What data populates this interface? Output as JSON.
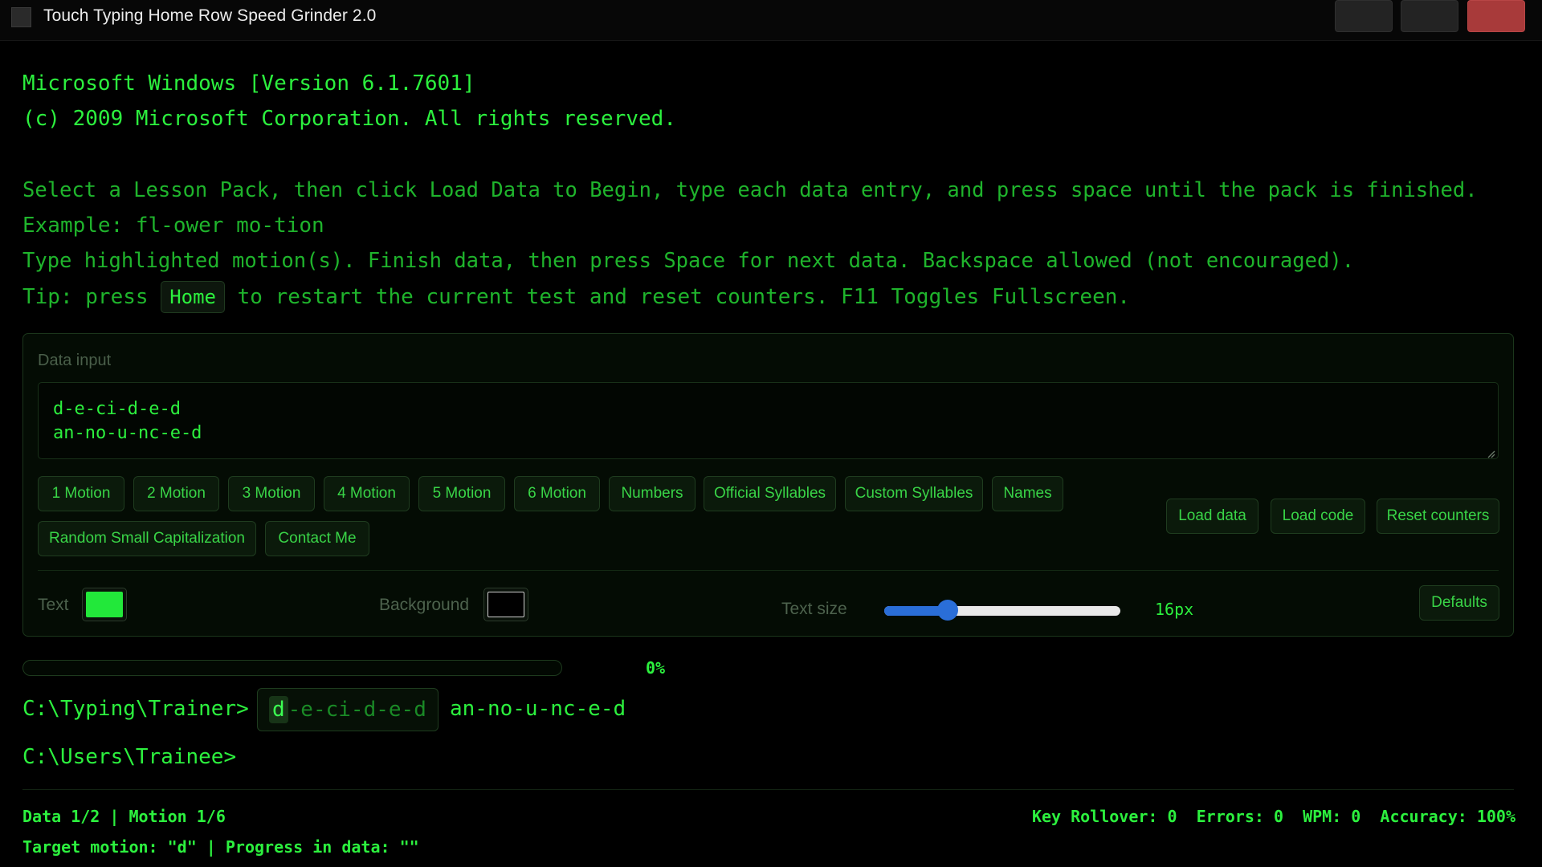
{
  "window": {
    "title": "Touch Typing Home Row Speed Grinder 2.0"
  },
  "console": {
    "version_line": "Microsoft Windows [Version 6.1.7601]",
    "copyright_line": "(c) 2009 Microsoft Corporation. All rights reserved.",
    "instruction_line": "Select a Lesson Pack, then click Load Data to Begin, type each data entry, and press space until the pack is finished.",
    "example_line": "Example: fl-ower mo-tion",
    "type_line": "Type highlighted motion(s). Finish data, then press Space for next data. Backspace allowed (not encouraged).",
    "tip_prefix": "Tip: press ",
    "tip_key": "Home",
    "tip_suffix": " to restart the current test and reset counters. F11 Toggles Fullscreen."
  },
  "panel": {
    "data_input_label": "Data input",
    "data_input_value": "d-e-ci-d-e-d\nan-no-u-nc-e-d",
    "lesson_buttons": [
      "1 Motion",
      "2 Motion",
      "3 Motion",
      "4 Motion",
      "5 Motion",
      "6 Motion",
      "Numbers",
      "Official Syllables",
      "Custom Syllables",
      "Names",
      "Random Small Capitalization",
      "Contact Me"
    ],
    "action_buttons": {
      "load_data": "Load data",
      "load_code": "Load code",
      "reset_counters": "Reset counters"
    },
    "text_label": "Text",
    "background_label": "Background",
    "text_color": "#22e83a",
    "background_color": "#000000",
    "text_size_label": "Text size",
    "text_size_value": "16px",
    "text_size_slider_fraction": 0.27,
    "defaults_button": "Defaults"
  },
  "progress": {
    "percent_value": 0,
    "percent_text": "0%"
  },
  "trainer": {
    "prompt": "C:\\Typing\\Trainer>",
    "current_target": "d",
    "current_rest": "-e-ci-d-e-d",
    "next_word": "an-no-u-nc-e-d",
    "user_prompt": "C:\\Users\\Trainee>"
  },
  "status": {
    "position": "Data 1/2 | Motion 1/6",
    "target": "Target motion: \"d\" | Progress in data: \"\"",
    "stats": "Key Rollover: 0  Errors: 0  WPM: 0  Accuracy: 100%"
  },
  "colors": {
    "accent_green": "#22e83a",
    "close_button": "#a83a3a",
    "slider_blue": "#2a6ed8"
  }
}
